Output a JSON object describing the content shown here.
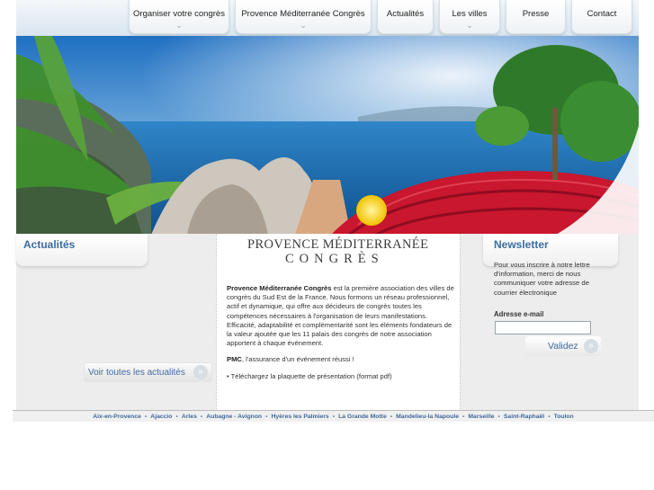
{
  "nav": {
    "items": [
      {
        "label": "Organiser votre congrès",
        "dropdown": true
      },
      {
        "label": "Provence Méditerranée Congrès",
        "dropdown": true
      },
      {
        "label": "Actualités",
        "dropdown": false
      },
      {
        "label": "Les villes",
        "dropdown": true
      },
      {
        "label": "Presse",
        "dropdown": false
      },
      {
        "label": "Contact",
        "dropdown": false
      }
    ]
  },
  "news": {
    "title": "Actualités",
    "more_label": "Voir toutes les actualités"
  },
  "logo": {
    "line1": "PROVENCE MÉDITERRANÉE",
    "line2": "CONGRÈS"
  },
  "intro": {
    "brand": "Provence Méditerranée Congrès",
    "text1": " est la première association des villes de congrès du Sud Est de la France. Nous formons un réseau professionnel, actif et dynamique, qui offre aux décideurs de congrès toutes les compétences nécessaires à l'organisation de leurs manifestations.",
    "text2": "Efficacité, adaptabilité et complémentarité sont les éléments fondateurs de la valeur ajoutée que les 11 palais des congrès de notre association apportent à chaque événement.",
    "pmc": "PMC",
    "pmc_text": ", l'assurance d'un événement réussi !",
    "download": "• Téléchargez la plaquette de présentation (format pdf)"
  },
  "newsletter": {
    "title": "Newsletter",
    "description": "Pour vous inscrire à notre lettre d'information, merci de nous communiquer votre adresse de courrier électronique",
    "email_label": "Adresse e-mail",
    "email_value": "",
    "submit_label": "Validez"
  },
  "footer": {
    "cities": [
      "Aix-en-Provence",
      "Ajaccio",
      "Arles",
      "Aubagne - Avignon",
      "Hyères les Palmiers",
      "La Grande Motte",
      "Mandelieu-la Napoule",
      "Marseille",
      "Saint-Raphaël",
      "Toulon"
    ],
    "separator": "•"
  },
  "colors": {
    "accent": "#3b6da3",
    "panel": "#ededed",
    "banner_sea": "#3a8ac8",
    "seats": "#c8172e"
  },
  "icons": {
    "nav_dropdown": "chevron-down-icon",
    "button_arrow": "double-chevron-right-icon"
  }
}
